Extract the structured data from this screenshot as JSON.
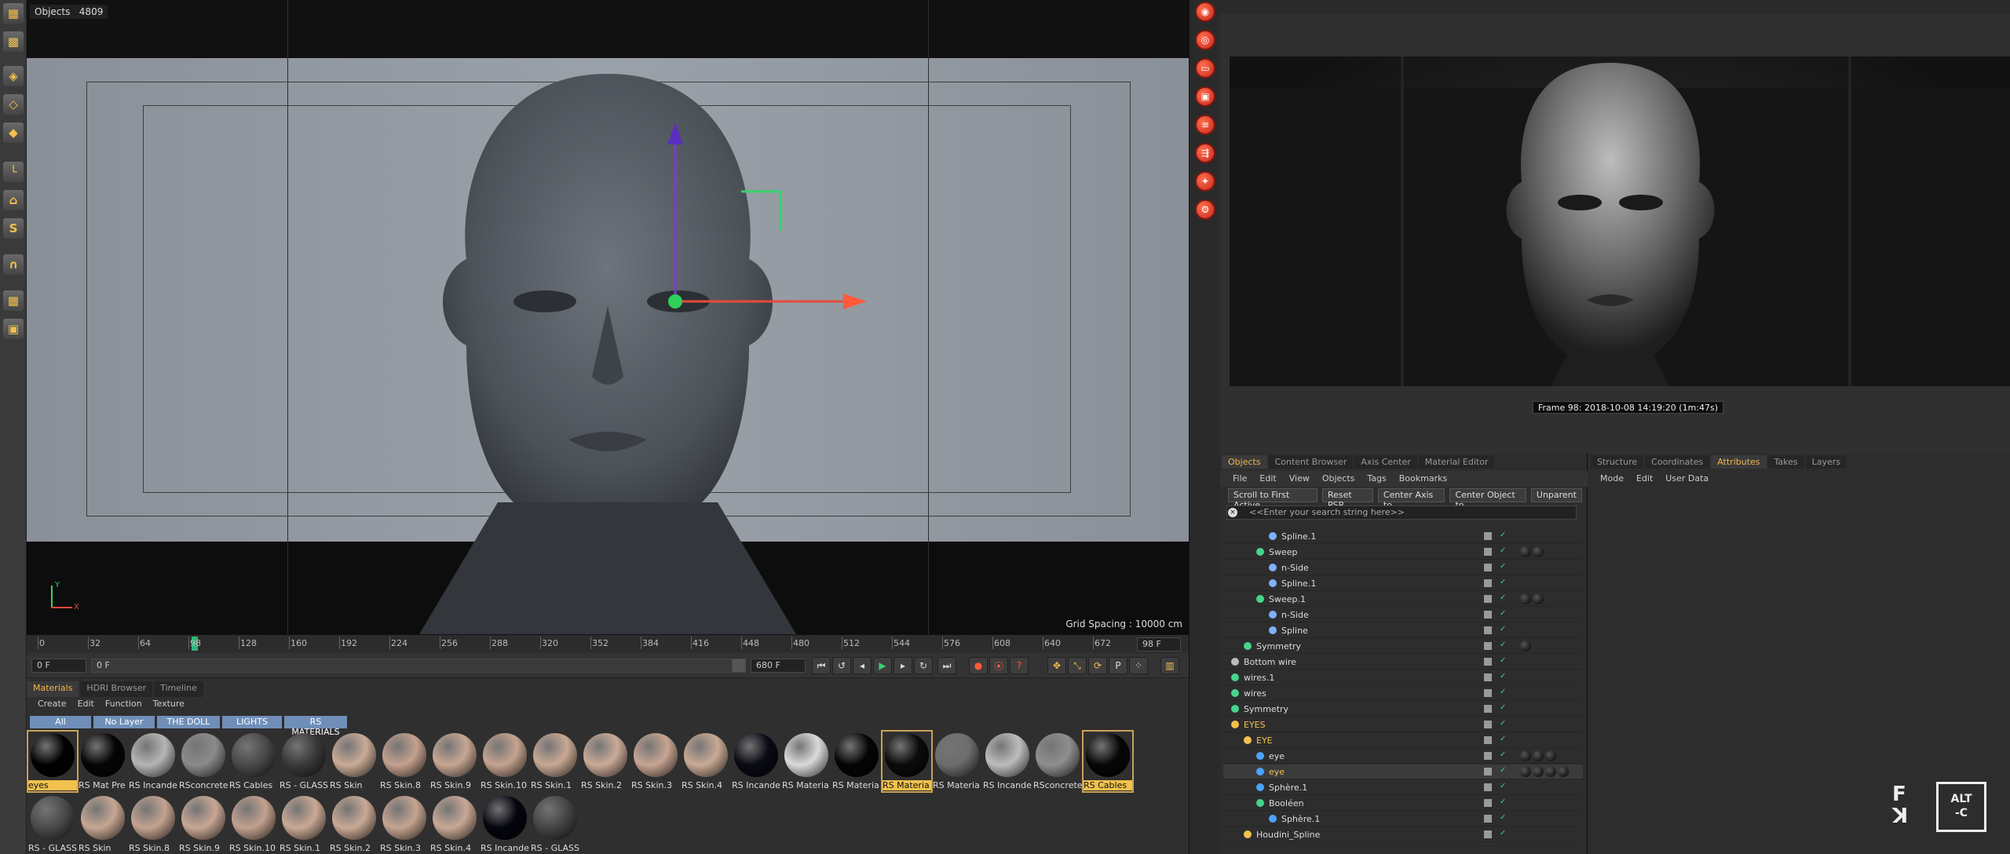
{
  "viewport": {
    "objects_label": "Objects",
    "objects_count": "4809",
    "grid_spacing": "Grid Spacing : 10000 cm",
    "axis_y": "Y",
    "axis_x": "X"
  },
  "timeline": {
    "ticks": [
      "0",
      "32",
      "64",
      "98",
      "128",
      "160",
      "192",
      "224",
      "256",
      "288",
      "320",
      "352",
      "384",
      "416",
      "448",
      "480",
      "512",
      "544",
      "576",
      "608",
      "640",
      "672"
    ],
    "current_frame": "98 F"
  },
  "transport": {
    "start_frame": "0 F",
    "min_field": "0 F",
    "max_field": "680 F",
    "end_frame": "680 F"
  },
  "materials": {
    "tabs": [
      "Materials",
      "HDRI Browser",
      "Timeline"
    ],
    "menu": [
      "Create",
      "Edit",
      "Function",
      "Texture"
    ],
    "filters": [
      "All",
      "No Layer",
      "THE DOLL",
      "LIGHTS",
      "RS MATERIALS"
    ],
    "items": [
      {
        "name": "eyes",
        "color": "#000000",
        "selected": true
      },
      {
        "name": "RS Mat Pre",
        "color": "#050505"
      },
      {
        "name": "RS Incande",
        "color": "#b5b5b5"
      },
      {
        "name": "RSconcrete",
        "color": "#8b8b8b"
      },
      {
        "name": "RS Cables",
        "color": "#4a4a4a"
      },
      {
        "name": "RS - GLASS",
        "color": "#3a3a3a"
      },
      {
        "name": "RS Skin",
        "color": "#c9ab97"
      },
      {
        "name": "RS Skin.8",
        "color": "#c4a08e"
      },
      {
        "name": "RS Skin.9",
        "color": "#c8a794"
      },
      {
        "name": "RS Skin.10",
        "color": "#c5a390"
      },
      {
        "name": "RS Skin.1",
        "color": "#c9a894"
      },
      {
        "name": "RS Skin.2",
        "color": "#caab98"
      },
      {
        "name": "RS Skin.3",
        "color": "#c7a592"
      },
      {
        "name": "RS Skin.4",
        "color": "#c9aa96"
      },
      {
        "name": "RS Incande",
        "color": "#0a0a14"
      },
      {
        "name": "RS Materia",
        "color": "#dadada"
      },
      {
        "name": "RS Materia",
        "color": "#050505"
      },
      {
        "name": "RS Materia",
        "color": "#0b0b0b",
        "selected": true
      },
      {
        "name": "RS Materia",
        "color": "#6d6d6d"
      },
      {
        "name": "RS Incande",
        "color": "#bdbdbd"
      },
      {
        "name": "RSconcrete",
        "color": "#8e8e8e"
      },
      {
        "name": "RS Cables",
        "color": "#070707",
        "selected": true
      },
      {
        "name": "RS - GLASS",
        "color": "#4b4b4b"
      },
      {
        "name": "RS Skin",
        "color": "#c6a692"
      },
      {
        "name": "RS Skin.8",
        "color": "#c4a290"
      },
      {
        "name": "RS Skin.9",
        "color": "#c8a794"
      },
      {
        "name": "RS Skin.10",
        "color": "#c3a18f"
      },
      {
        "name": "RS Skin.1",
        "color": "#caa995"
      },
      {
        "name": "RS Skin.2",
        "color": "#c9a995"
      },
      {
        "name": "RS Skin.3",
        "color": "#c5a490"
      },
      {
        "name": "RS Skin.4",
        "color": "#c8a895"
      },
      {
        "name": "RS Incande",
        "color": "#050510"
      },
      {
        "name": "RS - GLASS",
        "color": "#454545"
      }
    ]
  },
  "picture_viewer": {
    "caption": "Frame 98: 2018-10-08 14:19:20 (1m:47s)"
  },
  "object_manager": {
    "tabs": [
      "Objects",
      "Content Browser",
      "Axis Center",
      "Material Editor"
    ],
    "menu": [
      "File",
      "Edit",
      "View",
      "Objects",
      "Tags",
      "Bookmarks"
    ],
    "actions": [
      "Scroll to First Active",
      "Reset PSR",
      "Center Axis to",
      "Center Object to",
      "Unparent"
    ],
    "search_placeholder": "<<Enter your search string here>>",
    "rows": [
      {
        "name": "Spline.1",
        "indent": 3,
        "icon": "#7fb0ff"
      },
      {
        "name": "Sweep",
        "indent": 2,
        "icon": "#46d48a",
        "tags": 2
      },
      {
        "name": "n-Side",
        "indent": 3,
        "icon": "#7fb0ff"
      },
      {
        "name": "Spline.1",
        "indent": 3,
        "icon": "#7fb0ff"
      },
      {
        "name": "Sweep.1",
        "indent": 2,
        "icon": "#46d48a",
        "tags": 2
      },
      {
        "name": "n-Side",
        "indent": 3,
        "icon": "#7fb0ff"
      },
      {
        "name": "Spline",
        "indent": 3,
        "icon": "#7fb0ff"
      },
      {
        "name": "Symmetry",
        "indent": 1,
        "icon": "#46d48a",
        "tags": 1
      },
      {
        "name": "Bottom wire",
        "indent": 0,
        "icon": "#bbbbbb"
      },
      {
        "name": "wires.1",
        "indent": 0,
        "icon": "#46d48a"
      },
      {
        "name": "wires",
        "indent": 0,
        "icon": "#46d48a"
      },
      {
        "name": "Symmetry",
        "indent": 0,
        "icon": "#46d48a"
      },
      {
        "name": "EYES",
        "indent": 0,
        "icon": "#f2c14e",
        "hl": true
      },
      {
        "name": "EYE",
        "indent": 1,
        "icon": "#f2c14e",
        "hl": true
      },
      {
        "name": "eye",
        "indent": 2,
        "icon": "#4aa3ff",
        "tags": 3
      },
      {
        "name": "eye",
        "indent": 2,
        "icon": "#4aa3ff",
        "hl": true,
        "sel": true,
        "tags": 4
      },
      {
        "name": "Sphère.1",
        "indent": 2,
        "icon": "#4aa3ff"
      },
      {
        "name": "Booléen",
        "indent": 2,
        "icon": "#46d48a"
      },
      {
        "name": "Sphère.1",
        "indent": 3,
        "icon": "#4aa3ff"
      },
      {
        "name": "Houdini_Spline",
        "indent": 1,
        "icon": "#f2c14e"
      }
    ]
  },
  "attributes": {
    "tabs": [
      "Structure",
      "Coordinates",
      "Attributes",
      "Takes",
      "Layers"
    ],
    "menu": [
      "Mode",
      "Edit",
      "User Data"
    ]
  },
  "logo": {
    "mark": "F\nꓘ",
    "box_line1": "ALT",
    "box_line2": "-C"
  }
}
